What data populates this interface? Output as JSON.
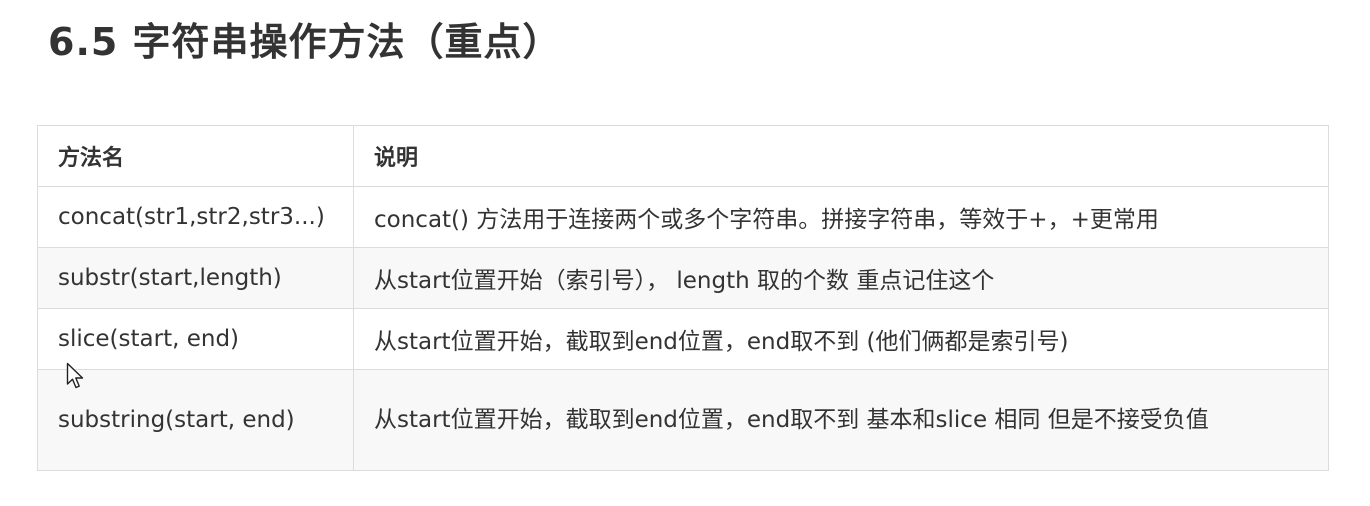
{
  "heading": "6.5 字符串操作方法（重点）",
  "table": {
    "headers": [
      "方法名",
      "说明"
    ],
    "rows": [
      {
        "name": "concat(str1,str2,str3...)",
        "desc": "concat() 方法用于连接两个或多个字符串。拼接字符串，等效于+，+更常用"
      },
      {
        "name": "substr(start,length)",
        "desc": "从start位置开始（索引号）， length  取的个数   重点记住这个"
      },
      {
        "name": "slice(start, end)",
        "desc": "从start位置开始，截取到end位置，end取不到 (他们俩都是索引号)"
      },
      {
        "name": "substring(start, end)",
        "desc": "从start位置开始，截取到end位置，end取不到   基本和slice 相同 但是不接受负值"
      }
    ]
  },
  "cursor": {
    "icon": "mouse-pointer-icon"
  }
}
